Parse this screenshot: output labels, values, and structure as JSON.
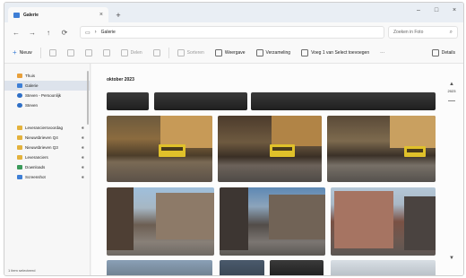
{
  "window": {
    "tab_title": "Galerie",
    "tab_close": "×",
    "new_tab": "+",
    "controls": {
      "minimize": "–",
      "maximize": "□",
      "close": "×"
    }
  },
  "address": {
    "back": "←",
    "forward": "→",
    "up": "↑",
    "refresh": "⟳",
    "monitor_icon": "▭",
    "chevron": "›",
    "path": "Galerie",
    "search_placeholder": "Zoeken in Foto",
    "search_icon": "⌕"
  },
  "commands": {
    "new": "Nieuw",
    "share": "Delen",
    "items": [
      {
        "label": "Sorteren",
        "icon": "sort-icon",
        "dim": true
      },
      {
        "label": "Weergave",
        "icon": "view-icon",
        "dim": false
      },
      {
        "label": "Verzameling",
        "icon": "collection-icon",
        "dim": false
      },
      {
        "label": "Voeg 1 van Select toevoegen",
        "icon": "add-icon",
        "dim": false
      }
    ],
    "more": "⋯",
    "details": "Details"
  },
  "sidebar": {
    "items": [
      {
        "label": "Thuis",
        "color": "#e8a03a",
        "active": false,
        "pinned": false
      },
      {
        "label": "Galerie",
        "color": "#3e7fd6",
        "active": true,
        "pinned": false
      },
      {
        "label": "Steven - Persoonlijk",
        "color": "#2f6fc6",
        "active": false,
        "pinned": false
      },
      {
        "label": "Steven",
        "color": "#2f6fc6",
        "active": false,
        "pinned": false
      }
    ],
    "folders": [
      {
        "label": "Leveranciersvoordag",
        "color": "#e3b23c",
        "pinned": true
      },
      {
        "label": "Nieuwsbrieven Q4",
        "color": "#e3b23c",
        "pinned": true
      },
      {
        "label": "Nieuwsbrieven Q3",
        "color": "#e3b23c",
        "pinned": true
      },
      {
        "label": "Leveranciers",
        "color": "#e3b23c",
        "pinned": true
      },
      {
        "label": "Downloads",
        "color": "#3a9a5a",
        "pinned": true
      },
      {
        "label": "Screenshot",
        "color": "#3e7fd6",
        "pinned": true
      }
    ],
    "pin_icon": "✱",
    "status": "1 item selecteerd"
  },
  "main": {
    "section_title": "oktober 2023",
    "timeline": {
      "year": "2023",
      "up_arrow": "▲",
      "down_arrow": "▼"
    }
  },
  "colors": {
    "accent": "#3e7fd6",
    "tram": "#e0c12a"
  }
}
